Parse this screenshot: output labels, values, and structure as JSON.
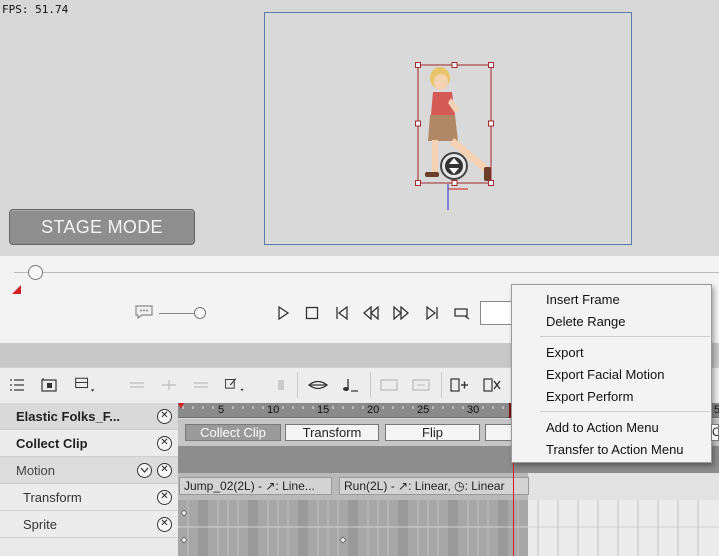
{
  "stage": {
    "fps_label": "FPS: 51.74",
    "mode_button": "STAGE MODE"
  },
  "timeline": {
    "ruler_ticks": [
      "5",
      "10",
      "15",
      "20",
      "25",
      "30",
      "5"
    ],
    "rows": [
      {
        "label": "Elastic Folks_F...",
        "style": "bold"
      },
      {
        "label": "Collect Clip",
        "style": "bold"
      },
      {
        "label": "Motion",
        "style": "normal"
      },
      {
        "label": "Transform",
        "style": "normal"
      },
      {
        "label": "Sprite",
        "style": "normal"
      }
    ],
    "track_buttons": [
      "Collect Clip",
      "Transform",
      "Flip"
    ],
    "clips": [
      {
        "label": "Jump_02(2L) - ↗: Line..."
      },
      {
        "label": "Run(2L) - ↗: Linear, ◷: Linear"
      }
    ]
  },
  "context_menu": {
    "items": [
      "Insert Frame",
      "Delete Range",
      "Export",
      "Export Facial Motion",
      "Export Perform",
      "Add to Action Menu",
      "Transfer to Action Menu"
    ]
  },
  "colors": {
    "selection_box": "#a1282b",
    "playhead": "#d02020",
    "viewport_border": "#5a7ba6"
  },
  "icons": {
    "playback": [
      "subtitle-icon",
      "play-icon",
      "stop-icon",
      "previous-key-icon",
      "step-back-icon",
      "step-forward-icon",
      "next-key-icon",
      "loop-icon"
    ],
    "toolbar": [
      "list-icon",
      "add-frame-icon",
      "layer-dropdown-icon",
      "edit-dropdown-icon",
      "mouth-icon",
      "music-note-icon",
      "insert-icon",
      "remove-icon"
    ]
  }
}
